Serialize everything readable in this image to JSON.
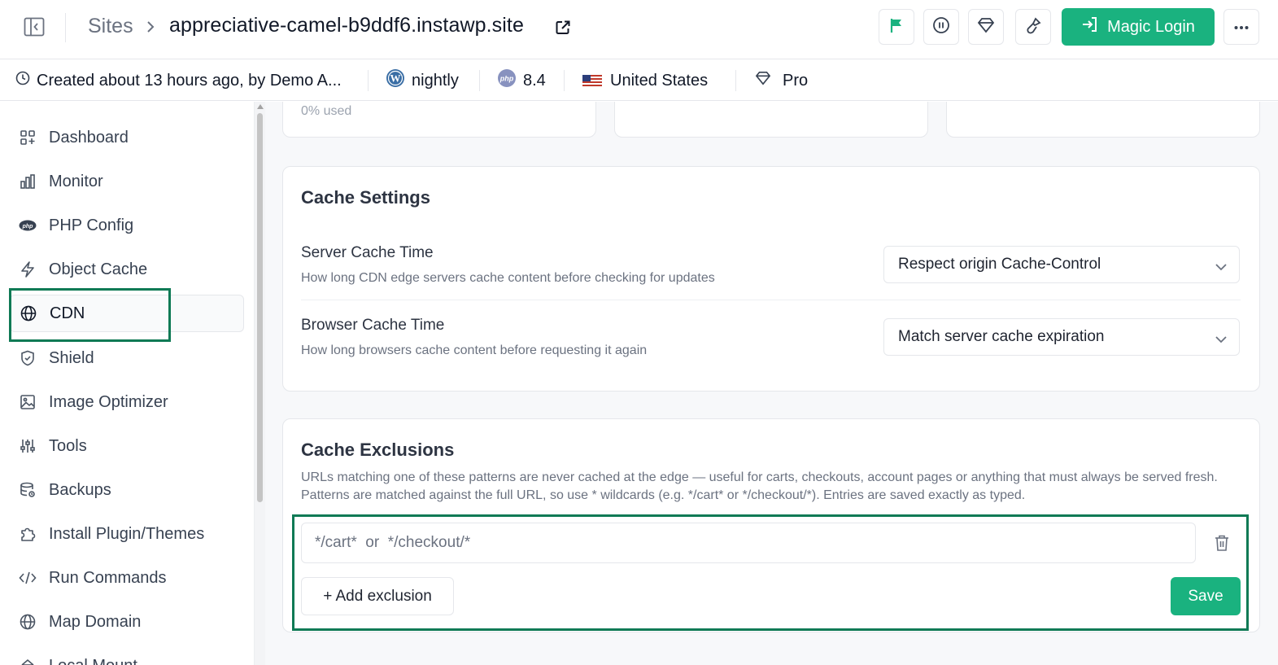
{
  "header": {
    "breadcrumb_root": "Sites",
    "site_name": "appreciative-camel-b9ddf6.instawp.site",
    "magic_login_label": "Magic Login",
    "accent_color": "#1ab27f",
    "icons": [
      "sidebar-toggle-icon",
      "external-link-icon",
      "flag-icon",
      "pause-icon",
      "gem-icon",
      "brush-icon",
      "login-icon",
      "more-icon"
    ]
  },
  "infobar": {
    "created": "Created about 13 hours ago, by Demo A...",
    "wp_version": "nightly",
    "php_version": "8.4",
    "region": "United States",
    "plan": "Pro"
  },
  "sidebar": {
    "items": [
      {
        "label": "Dashboard",
        "icon": "dashboard-icon"
      },
      {
        "label": "Monitor",
        "icon": "bar-chart-icon"
      },
      {
        "label": "PHP Config",
        "icon": "php-icon"
      },
      {
        "label": "Object Cache",
        "icon": "lightning-icon"
      },
      {
        "label": "CDN",
        "icon": "globe-icon",
        "active": true
      },
      {
        "label": "Shield",
        "icon": "shield-icon"
      },
      {
        "label": "Image Optimizer",
        "icon": "image-icon"
      },
      {
        "label": "Tools",
        "icon": "sliders-icon"
      },
      {
        "label": "Backups",
        "icon": "database-icon"
      },
      {
        "label": "Install Plugin/Themes",
        "icon": "puzzle-icon"
      },
      {
        "label": "Run Commands",
        "icon": "code-icon"
      },
      {
        "label": "Map Domain",
        "icon": "globe-icon"
      },
      {
        "label": "Local Mount",
        "icon": "mount-icon"
      }
    ]
  },
  "usage": {
    "used_text": "0% used"
  },
  "cache_settings": {
    "title": "Cache Settings",
    "server": {
      "title": "Server Cache Time",
      "desc": "How long CDN edge servers cache content before checking for updates",
      "value": "Respect origin Cache-Control"
    },
    "browser": {
      "title": "Browser Cache Time",
      "desc": "How long browsers cache content before requesting it again",
      "value": "Match server cache expiration"
    }
  },
  "cache_exclusions": {
    "title": "Cache Exclusions",
    "desc": "URLs matching one of these patterns are never cached at the edge — useful for carts, checkouts, account pages or anything that must always be served fresh. Patterns are matched against the full URL, so use * wildcards (e.g. */cart* or */checkout/*). Entries are saved exactly as typed.",
    "input_placeholder": "*/cart*  or  */checkout/*",
    "add_label": "+ Add exclusion",
    "save_label": "Save"
  }
}
